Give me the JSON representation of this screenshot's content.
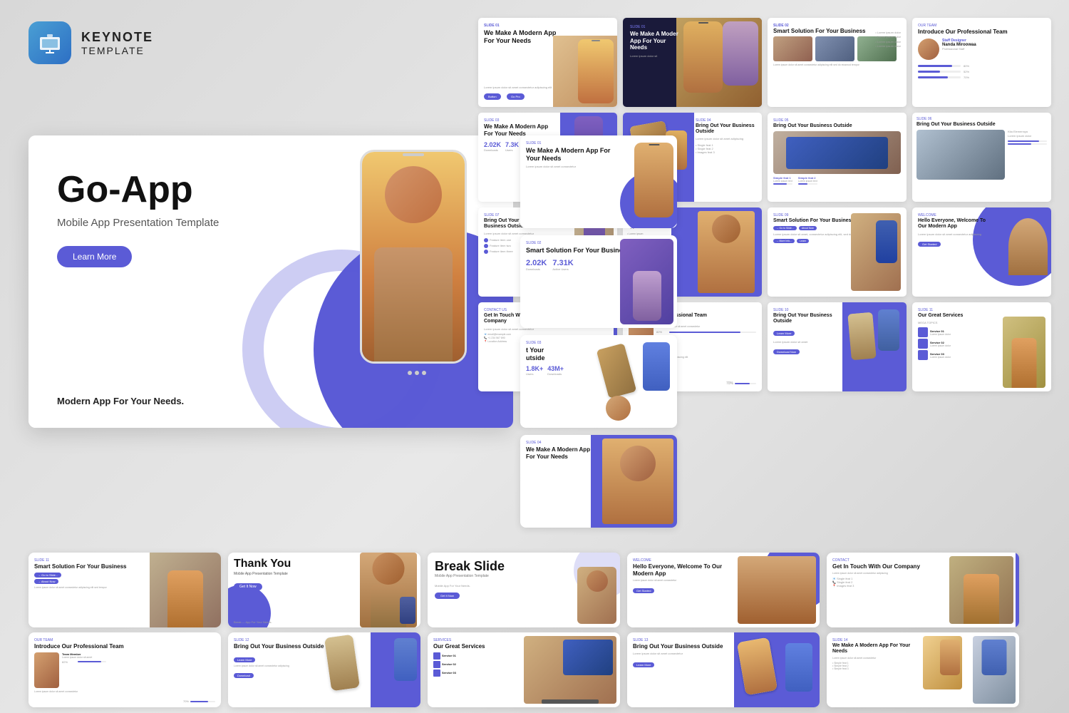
{
  "app": {
    "icon_label": "Keynote Icon",
    "title": "KEYNOTE",
    "subtitle": "TEMPLATE"
  },
  "hero_slide": {
    "title": "Go-App",
    "subtitle": "Mobile App Presentation Template",
    "cta_label": "Learn More",
    "tagline": "Modern App For Your Needs."
  },
  "slides": [
    {
      "id": 1,
      "title": "We Make A Modern App For Your Needs",
      "type": "hero"
    },
    {
      "id": 2,
      "title": "We Make A Modern App For Your Needs",
      "type": "hero-dark"
    },
    {
      "id": 3,
      "title": "Smart Solution For Your Business",
      "type": "stats"
    },
    {
      "id": 4,
      "title": "Introduce Our Professional Team",
      "type": "team"
    },
    {
      "id": 5,
      "title": "Bring Out Your Business Outside",
      "type": "features"
    },
    {
      "id": 6,
      "title": "Bring Out Your Business Outside",
      "type": "features2"
    },
    {
      "id": 7,
      "title": "Bring Out Your Business Outside",
      "type": "features3"
    },
    {
      "id": 8,
      "title": "We Make A Modern App For Your Needs",
      "type": "hero3"
    },
    {
      "id": 9,
      "title": "Smart Solution For Your Business",
      "type": "business"
    },
    {
      "id": 10,
      "title": "Thank You",
      "type": "thankyou"
    },
    {
      "id": 11,
      "title": "Break Slide",
      "type": "break"
    },
    {
      "id": 12,
      "title": "Hello Everyone, Welcome To Our Modern App",
      "type": "welcome"
    },
    {
      "id": 13,
      "title": "Get In Touch With Our Company",
      "type": "contact"
    },
    {
      "id": 14,
      "title": "Introduce Our Professional Team",
      "type": "team2"
    },
    {
      "id": 15,
      "title": "Bring Out Your Business Outside",
      "type": "features4"
    },
    {
      "id": 16,
      "title": "Our Great Services",
      "type": "services"
    },
    {
      "id": 17,
      "title": "Bring Out Your Business Outside",
      "type": "features5"
    },
    {
      "id": 18,
      "title": "We Make A Modern App For Your Needs",
      "type": "hero4"
    },
    {
      "id": 19,
      "title": "We Make A Modern App For Your Needs",
      "type": "hero5"
    },
    {
      "id": 20,
      "title": "Bring Out Your Business Outside",
      "type": "features6"
    }
  ],
  "colors": {
    "purple": "#5b5bd6",
    "dark_purple": "#4040c0",
    "white": "#ffffff",
    "text_dark": "#111111",
    "text_gray": "#888888",
    "bg": "#d8d8d8"
  }
}
